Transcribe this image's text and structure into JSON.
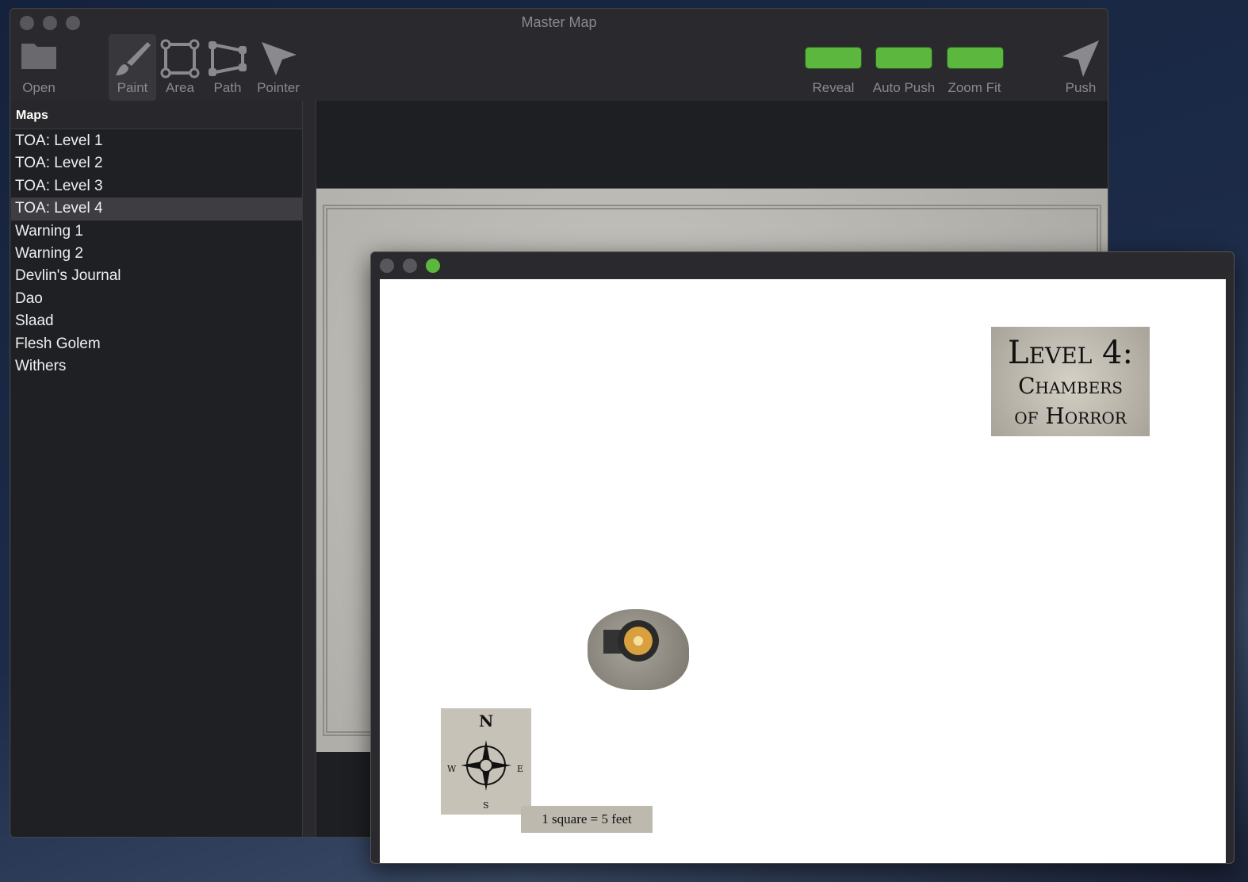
{
  "window": {
    "title": "Master Map"
  },
  "toolbar": {
    "open": "Open",
    "paint": "Paint",
    "area": "Area",
    "path": "Path",
    "pointer": "Pointer",
    "reveal": "Reveal",
    "auto_push": "Auto Push",
    "zoom_fit": "Zoom Fit",
    "push": "Push",
    "button_color": "#5cb73e"
  },
  "sidebar": {
    "header": "Maps",
    "selected": "TOA: Level 4",
    "items": [
      "TOA: Level 1",
      "TOA: Level 2",
      "TOA: Level 3",
      "TOA: Level 4",
      "Warning 1",
      "Warning 2",
      "Devlin's Journal",
      "Dao",
      "Slaad",
      "Flesh Golem",
      "Withers"
    ]
  },
  "preview": {
    "title_line1": "Level 4:",
    "title_line2": "Chambers",
    "title_line3": "of Horror",
    "compass": {
      "n": "N",
      "s": "S",
      "e": "E",
      "w": "W"
    },
    "scale": "1 square = 5 feet"
  }
}
